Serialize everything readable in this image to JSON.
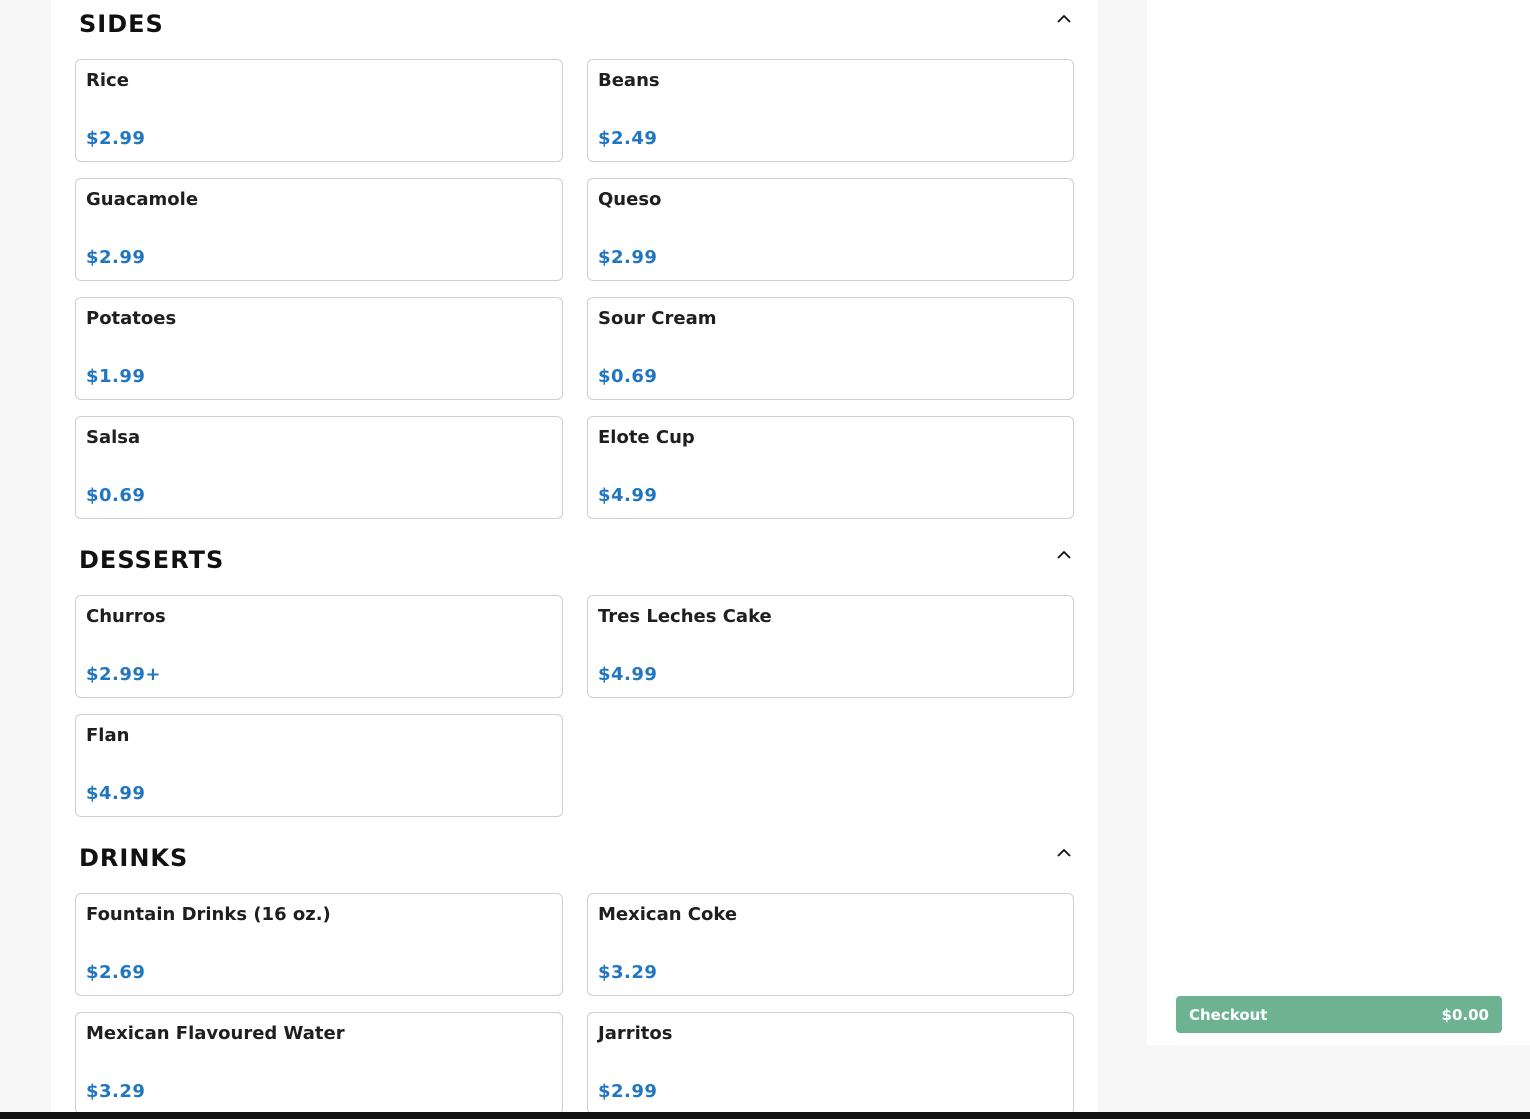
{
  "sections": [
    {
      "title": "SIDES",
      "items": [
        {
          "name": "Rice",
          "price": "$2.99"
        },
        {
          "name": "Beans",
          "price": "$2.49"
        },
        {
          "name": "Guacamole",
          "price": "$2.99"
        },
        {
          "name": "Queso",
          "price": "$2.99"
        },
        {
          "name": "Potatoes",
          "price": "$1.99"
        },
        {
          "name": "Sour Cream",
          "price": "$0.69"
        },
        {
          "name": "Salsa",
          "price": "$0.69"
        },
        {
          "name": "Elote Cup",
          "price": "$4.99"
        }
      ]
    },
    {
      "title": "DESSERTS",
      "items": [
        {
          "name": "Churros",
          "price": "$2.99+"
        },
        {
          "name": "Tres Leches Cake",
          "price": "$4.99"
        },
        {
          "name": "Flan",
          "price": "$4.99"
        }
      ]
    },
    {
      "title": "DRINKS",
      "items": [
        {
          "name": "Fountain Drinks (16 oz.)",
          "price": "$2.69"
        },
        {
          "name": "Mexican Coke",
          "price": "$3.29"
        },
        {
          "name": "Mexican Flavoured Water",
          "price": "$3.29"
        },
        {
          "name": "Jarritos",
          "price": "$2.99"
        }
      ]
    }
  ],
  "cart": {
    "checkout_label": "Checkout",
    "total": "$0.00"
  },
  "colors": {
    "price": "#2176c1",
    "checkout": "#6db391"
  },
  "icons": {
    "collapse": "chevron-up-icon"
  }
}
